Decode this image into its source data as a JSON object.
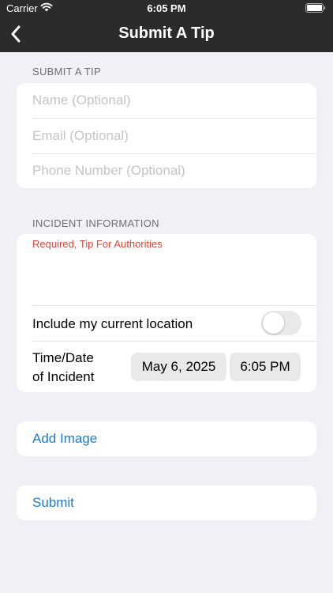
{
  "status_bar": {
    "carrier": "Carrier",
    "time": "6:05 PM"
  },
  "nav": {
    "title": "Submit A Tip",
    "back_icon": "chevron-left-icon"
  },
  "tip_section": {
    "header": "SUBMIT A TIP",
    "name_placeholder": "Name (Optional)",
    "email_placeholder": "Email (Optional)",
    "phone_placeholder": "Phone Number (Optional)"
  },
  "incident_section": {
    "header": "INCIDENT INFORMATION",
    "required_text": "Required, Tip For Authorities",
    "location_label": "Include my current location",
    "location_enabled": false,
    "time_date_label_line1": "Time/Date",
    "time_date_label_line2": "of Incident",
    "date_value": "May 6, 2025",
    "time_value": "6:05 PM"
  },
  "actions": {
    "add_image": "Add Image",
    "submit": "Submit"
  },
  "colors": {
    "nav_bg": "#2b2b2b",
    "page_bg": "#f1f0f6",
    "link": "#1c7bd1",
    "required": "#d9463b"
  }
}
